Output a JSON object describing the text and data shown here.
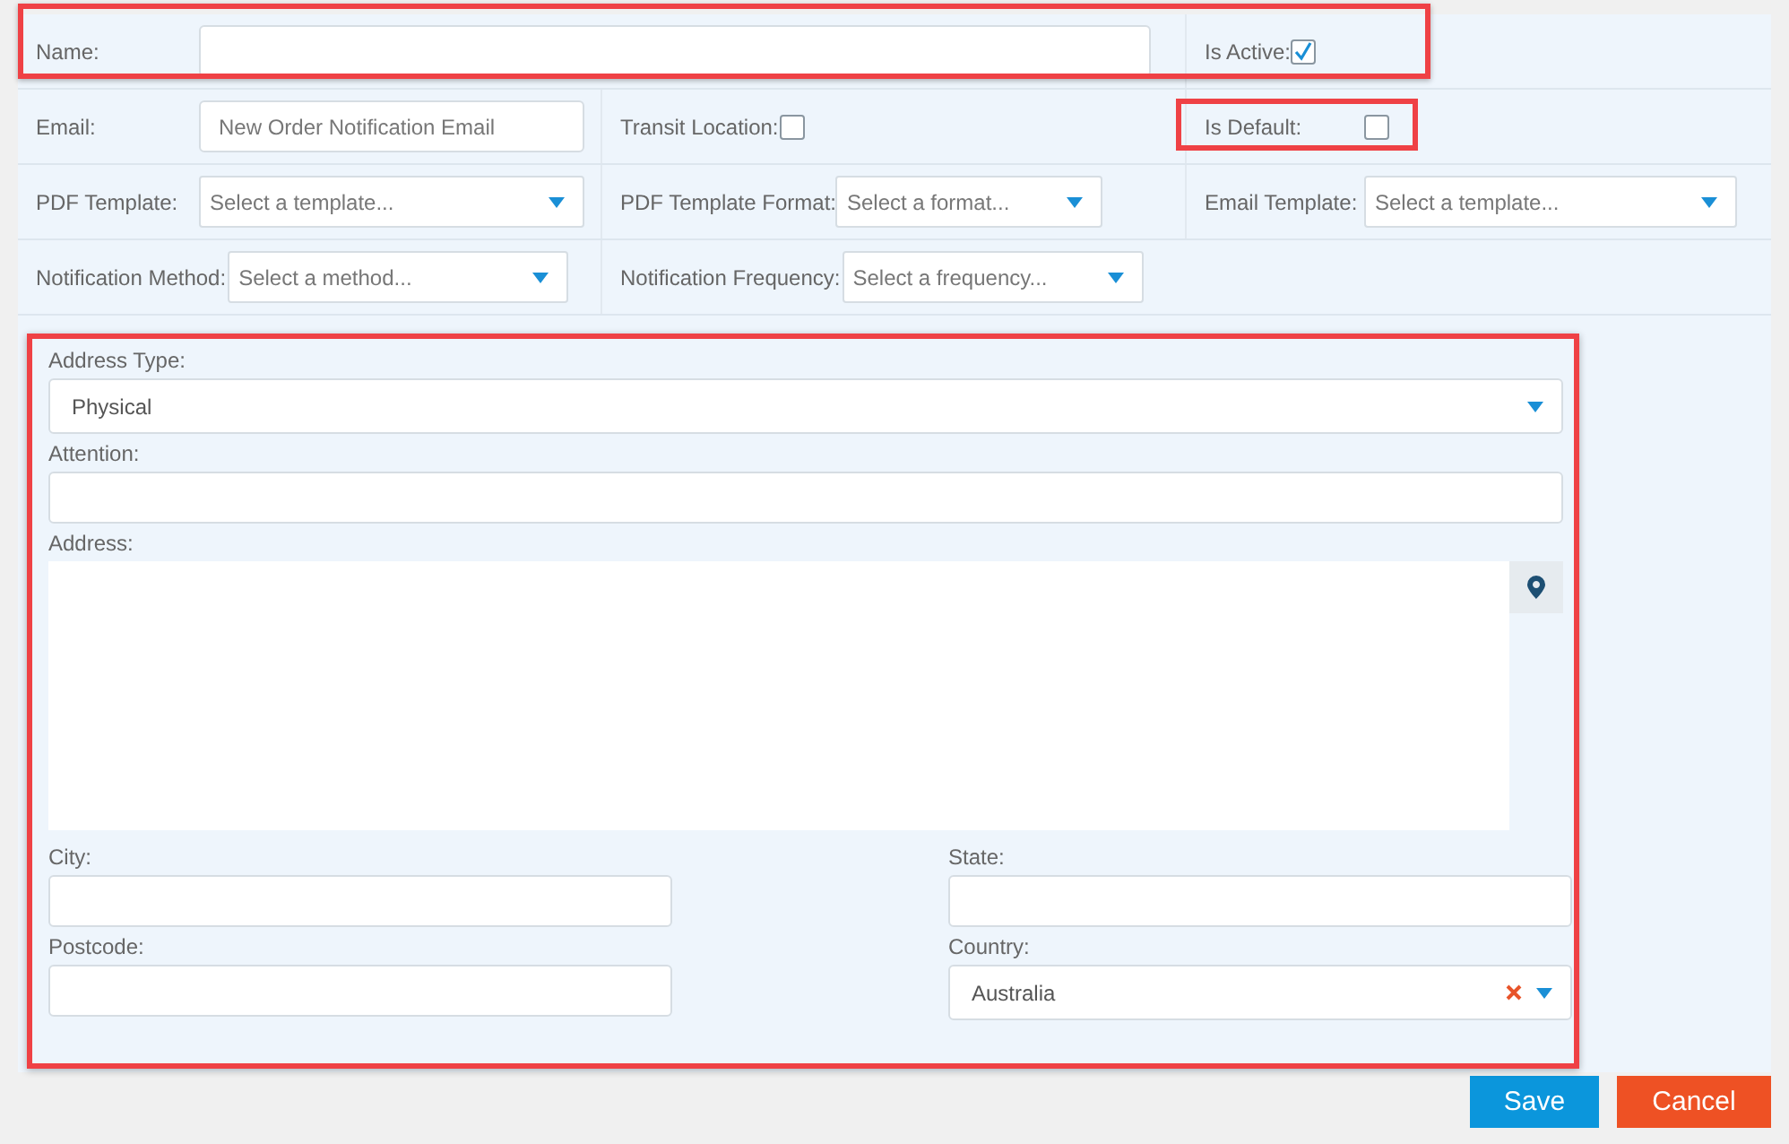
{
  "top_rows": [
    {
      "highlighted": true,
      "cells": [
        {
          "kind": "text",
          "label": "Name:",
          "wide": true,
          "highlighted": false
        },
        {
          "kind": "checkbox",
          "label": "Is Active:",
          "checked": true,
          "highlighted": false
        }
      ]
    },
    {
      "highlighted": false,
      "cells": [
        {
          "kind": "text",
          "label": "Email:",
          "placeholder": "New Order Notification Email",
          "highlighted": false
        },
        {
          "kind": "checkbox",
          "label": "Transit Location:",
          "checked": false,
          "highlighted": false
        },
        {
          "kind": "checkbox",
          "label": "Is Default:",
          "checked": false,
          "highlighted": true
        }
      ]
    },
    {
      "highlighted": false,
      "cells": [
        {
          "kind": "select",
          "label": "PDF Template:",
          "placeholder": "Select a template...",
          "highlighted": false
        },
        {
          "kind": "select",
          "label": "PDF Template Format:",
          "placeholder": "Select a format...",
          "highlighted": false
        },
        {
          "kind": "select",
          "label": "Email Template:",
          "placeholder": "Select a template...",
          "highlighted": false
        }
      ]
    },
    {
      "highlighted": false,
      "cells": [
        {
          "kind": "select",
          "label": "Notification Method:",
          "placeholder": "Select a method...",
          "highlighted": false
        },
        {
          "kind": "select",
          "label": "Notification Frequency:",
          "placeholder": "Select a frequency...",
          "highlighted": false
        }
      ]
    }
  ],
  "address": {
    "highlighted": true,
    "fields": [
      {
        "kind": "select",
        "label": "Address Type:",
        "value": "Physical"
      },
      {
        "kind": "text",
        "label": "Attention:"
      },
      {
        "kind": "textarea",
        "label": "Address:"
      }
    ],
    "pairs": [
      {
        "kind": "text",
        "label": "City:"
      },
      {
        "kind": "text",
        "label": "State:"
      },
      {
        "kind": "text",
        "label": "Postcode:"
      },
      {
        "kind": "select",
        "label": "Country:",
        "value": "Australia",
        "clearable": true
      }
    ]
  },
  "buttons": [
    {
      "label": "Save",
      "kind": "primary"
    },
    {
      "label": "Cancel",
      "kind": "danger"
    }
  ]
}
